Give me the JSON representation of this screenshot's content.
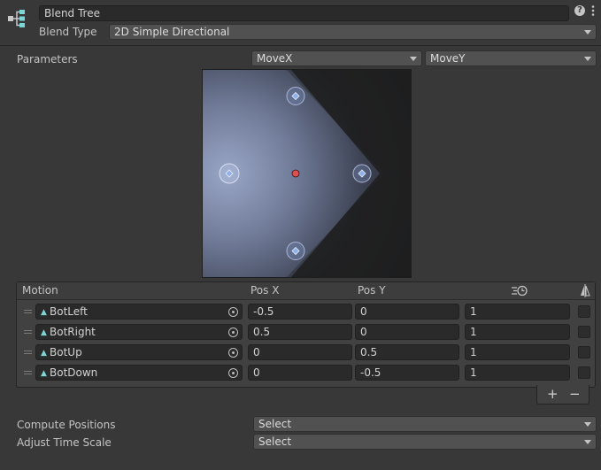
{
  "header": {
    "name_value": "Blend Tree",
    "blend_type_label": "Blend Type",
    "blend_type_value": "2D Simple Directional",
    "help_icon": "help-icon",
    "menu_icon": "kebab-menu-icon",
    "node_icon": "blend-tree-icon"
  },
  "parameters": {
    "label": "Parameters",
    "param_x": "MoveX",
    "param_y": "MoveY"
  },
  "graph": {
    "points": [
      {
        "name": "BotLeft",
        "x": -0.5,
        "y": 0
      },
      {
        "name": "BotRight",
        "x": 0.5,
        "y": 0
      },
      {
        "name": "BotUp",
        "x": 0,
        "y": 0.5
      },
      {
        "name": "BotDown",
        "x": 0,
        "y": -0.5
      }
    ],
    "current": {
      "x": 0,
      "y": 0
    },
    "colors": {
      "point_fill": "#8fb0e8",
      "current": "#e05050",
      "gradient_light": "#8b98bb"
    }
  },
  "motion_list": {
    "columns": {
      "motion": "Motion",
      "pos_x": "Pos X",
      "pos_y": "Pos Y",
      "speed_icon": "speed-icon",
      "mirror_icon": "mirror-icon"
    },
    "rows": [
      {
        "motion": "BotLeft",
        "pos_x": "-0.5",
        "pos_y": "0",
        "speed": "1",
        "mirror": false
      },
      {
        "motion": "BotRight",
        "pos_x": "0.5",
        "pos_y": "0",
        "speed": "1",
        "mirror": false
      },
      {
        "motion": "BotUp",
        "pos_x": "0",
        "pos_y": "0.5",
        "speed": "1",
        "mirror": false
      },
      {
        "motion": "BotDown",
        "pos_x": "0",
        "pos_y": "-0.5",
        "speed": "1",
        "mirror": false
      }
    ],
    "add_label": "+",
    "remove_label": "−"
  },
  "compute": {
    "compute_label": "Compute Positions",
    "compute_value": "Select",
    "adjust_label": "Adjust Time Scale",
    "adjust_value": "Select"
  }
}
